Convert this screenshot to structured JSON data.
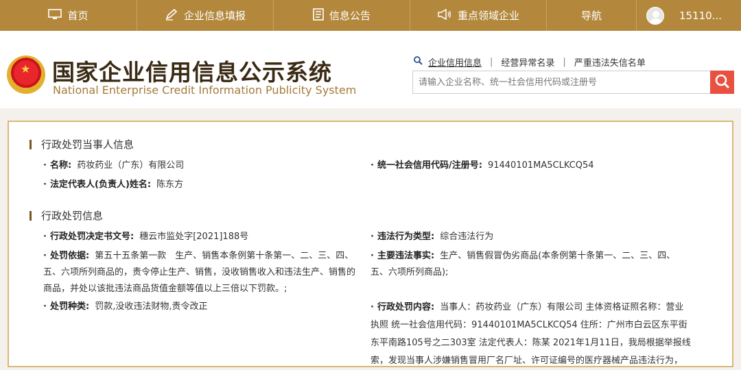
{
  "topnav": {
    "items": [
      {
        "label": "首页",
        "icon": "monitor-icon"
      },
      {
        "label": "企业信息填报",
        "icon": "pen-icon"
      },
      {
        "label": "信息公告",
        "icon": "document-icon"
      },
      {
        "label": "重点领域企业",
        "icon": "megaphone-icon"
      },
      {
        "label": "导航",
        "icon": ""
      }
    ],
    "user": "15110..."
  },
  "header": {
    "title_cn": "国家企业信用信息公示系统",
    "title_en": "National Enterprise Credit Information Publicity System",
    "links": [
      "企业信用信息",
      "经营异常名录",
      "严重违法失信名单"
    ],
    "search_placeholder": "请输入企业名称、统一社会信用代码或注册号"
  },
  "party": {
    "section_title": "行政处罚当事人信息",
    "name_label": "名称:",
    "name": "药妆药业（广东）有限公司",
    "code_label": "统一社会信用代码/注册号:",
    "code": "91440101MA5CLKCQ54",
    "rep_label": "法定代表人(负责人)姓名:",
    "rep": "陈东方"
  },
  "penalty": {
    "section_title": "行政处罚信息",
    "doc_label": "行政处罚决定书文号:",
    "doc": "穗云市监处字[2021]188号",
    "type_label": "违法行为类型:",
    "type": "综合违法行为",
    "basis_label": "处罚依据:",
    "basis_line1": "第五十五条第一款　生产、销售本条例第十条第一、二、三、四、",
    "basis_line2": "五、六项所列商品的，责令停止生产、销售，没收销售收入和违法生产、销售的",
    "basis_line3": "商品，并处以该批违法商品货值金额等值以上三倍以下罚款。;",
    "facts_label": "主要违法事实:",
    "facts_line1": "生产、销售假冒伪劣商品(本条例第十条第一、二、三、四、",
    "facts_line2": "五、六项所列商品);",
    "kind_label": "处罚种类:",
    "kind": "罚款,没收违法财物,责令改正",
    "content_label": "行政处罚内容:",
    "content_line1": "当事人：药妆药业（广东）有限公司 主体资格证照名称：营业",
    "content_line2": "执照 统一社会信用代码：91440101MA5CLKCQ54 住所：广州市白云区东平街",
    "content_line3": "东平南路105号之二303室 法定代表人：陈某 2021年1月11日，我局根据举报线",
    "content_line4": "索，发现当事人涉嫌销售冒用厂名厂址、许可证编号的医疗器械产品违法行为，"
  },
  "colors": {
    "nav_bg": "#b3883d",
    "accent": "#a57b3a",
    "search_btn": "#e8513f"
  }
}
